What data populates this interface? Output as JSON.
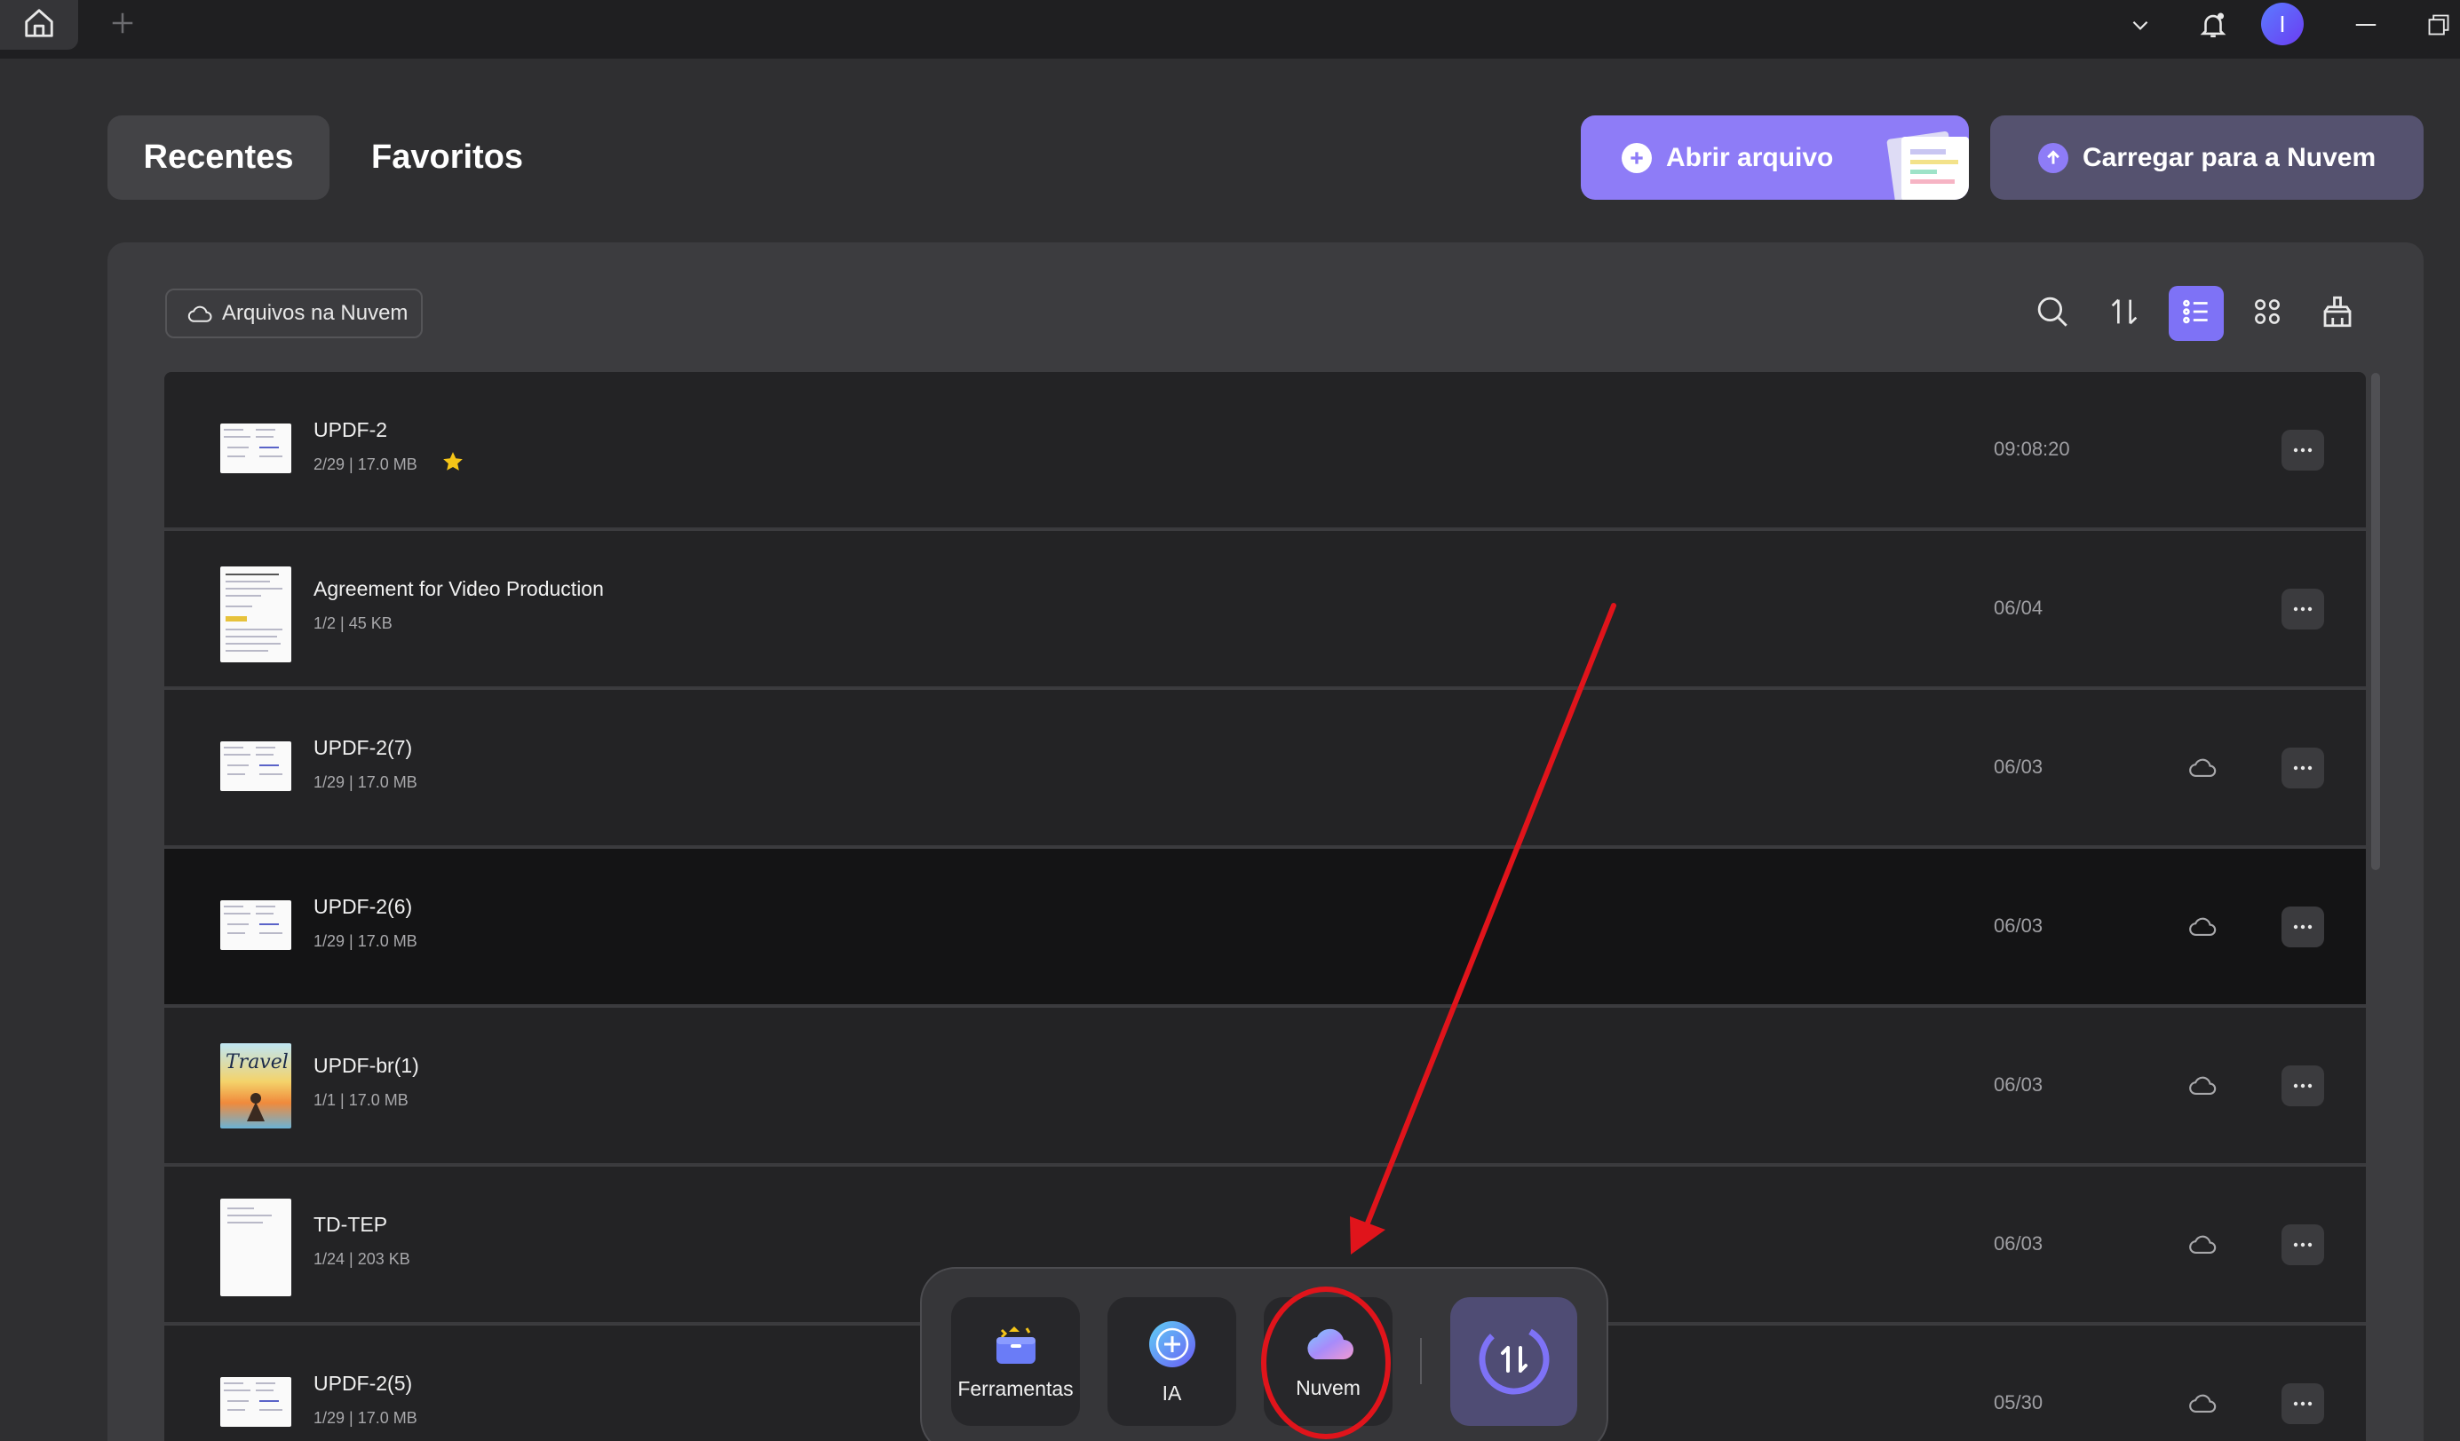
{
  "topbar": {
    "home_icon": "home-icon",
    "add_tab_icon": "plus-icon",
    "avatar_initial": "I"
  },
  "header": {
    "tabs": [
      {
        "label": "Recentes",
        "active": true
      },
      {
        "label": "Favoritos",
        "active": false
      }
    ],
    "open_file_label": "Abrir arquivo",
    "upload_cloud_label": "Carregar para a Nuvem"
  },
  "filter": {
    "cloud_files_label": "Arquivos na Nuvem"
  },
  "files": [
    {
      "name": "UPDF-2",
      "meta": "2/29 | 17.0 MB",
      "date": "09:08:20",
      "starred": true,
      "cloud": false
    },
    {
      "name": "Agreement for Video Production",
      "meta": "1/2 | 45 KB",
      "date": "06/04",
      "starred": false,
      "cloud": false
    },
    {
      "name": "UPDF-2(7)",
      "meta": "1/29 | 17.0 MB",
      "date": "06/03",
      "starred": false,
      "cloud": true
    },
    {
      "name": "UPDF-2(6)",
      "meta": "1/29 | 17.0 MB",
      "date": "06/03",
      "starred": false,
      "cloud": true
    },
    {
      "name": "UPDF-br(1)",
      "meta": "1/1 | 17.0 MB",
      "date": "06/03",
      "starred": false,
      "cloud": true
    },
    {
      "name": "TD-TEP",
      "meta": "1/24 | 203 KB",
      "date": "06/03",
      "starred": false,
      "cloud": true
    },
    {
      "name": "UPDF-2(5)",
      "meta": "1/29 | 17.0 MB",
      "date": "05/30",
      "starred": false,
      "cloud": true
    }
  ],
  "dock": {
    "tools_label": "Ferramentas",
    "ai_label": "IA",
    "cloud_label": "Nuvem"
  },
  "thumb_cover_text": "Travel",
  "colors": {
    "accent": "#8e7cf7",
    "annotation": "#e0141b",
    "star": "#f5c518"
  }
}
